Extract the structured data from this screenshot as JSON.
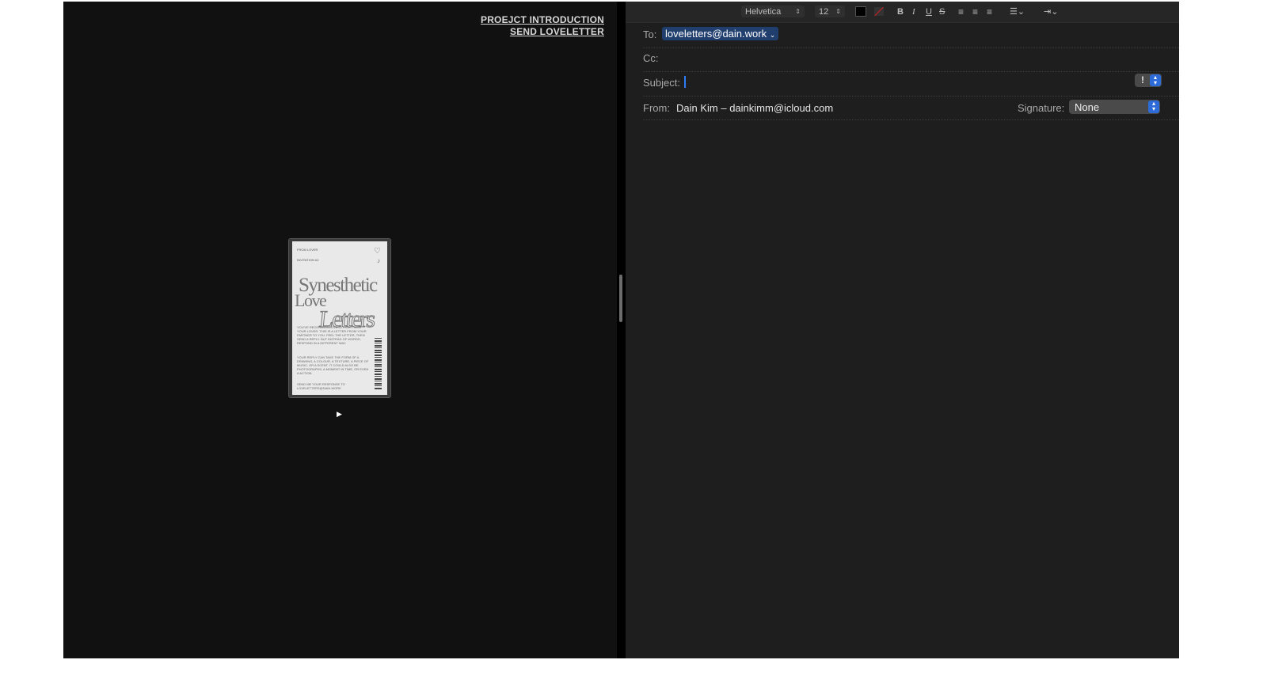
{
  "site": {
    "nav": [
      "PROEJCT INTRODUCTION",
      "SEND LOVELETTER"
    ],
    "card": {
      "from_label": "FROM LOVER",
      "invitation_label": "INVITATION #2",
      "title_line1": "Synesthetic",
      "title_line2": "Love",
      "title_line3": "Letters",
      "body_text": "YOU'VE RECEIVED A LOVE LETTER FROM YOUR LOVER. THIS IS A LETTER FROM YOUR PARTNER TO YOU. FEEL THE LETTER, THEN SEND A REPLY. BUT INSTEAD OF WORDS, RESPOND IN A DIFFERENT WAY.",
      "body_text2": "YOUR REPLY CAN TAKE THE FORM OF A DRAWING, A COLOUR, A TEXTURE, A PIECE OF MUSIC, OR A SCENT. IT COULD ALSO BE PHOTOGRAPHS, A MOMENT IN TIME, OR EVEN A ACTION.",
      "send_text": "SEND ME YOUR RESPONSE TO LOVELETTERS@DAIN.WORK"
    },
    "play_symbol": "▶"
  },
  "mail": {
    "toolbar": {
      "font": "Helvetica",
      "size": "12",
      "bold": "B",
      "italic": "I",
      "underline": "U",
      "strike": "S",
      "text_color": "#000000"
    },
    "to_label": "To:",
    "to_value": "loveletters@dain.work",
    "cc_label": "Cc:",
    "subject_label": "Subject:",
    "priority_symbol": "!",
    "from_label": "From:",
    "from_value": "Dain Kim – dainkimm@icloud.com",
    "signature_label": "Signature:",
    "signature_value": "None"
  }
}
